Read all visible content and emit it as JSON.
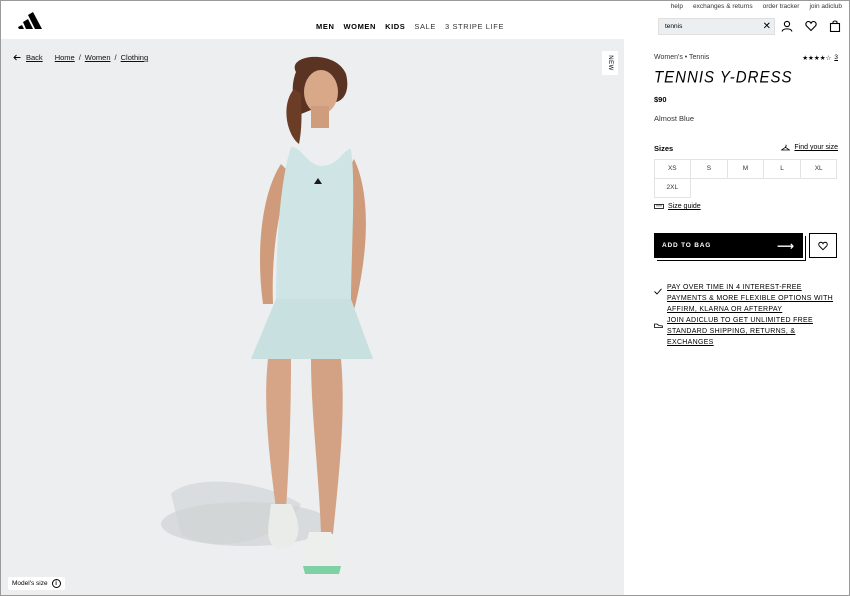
{
  "utility_links": [
    "help",
    "exchanges & returns",
    "order tracker",
    "join adiclub"
  ],
  "nav": {
    "items": [
      {
        "label": "MEN",
        "weight": "bold"
      },
      {
        "label": "WOMEN",
        "weight": "bold"
      },
      {
        "label": "KIDS",
        "weight": "bold"
      },
      {
        "label": "SALE",
        "weight": "light"
      },
      {
        "label": "3 STRIPE LIFE",
        "weight": "light"
      }
    ]
  },
  "search": {
    "value": "tennis",
    "clear_glyph": "✕"
  },
  "breadcrumb": {
    "back_label": "Back",
    "items": [
      "Home",
      "Women",
      "Clothing"
    ],
    "separator": "/"
  },
  "image": {
    "new_tag": "NEW",
    "model_size_label": "Model's size",
    "info_glyph": "i"
  },
  "product": {
    "category": "Women's • Tennis",
    "rating_stars": "★★★★☆",
    "rating_count": "3",
    "title": "TENNIS Y-DRESS",
    "price": "$90",
    "color": "Almost Blue",
    "sizes_label": "Sizes",
    "find_size_label": "Find your size",
    "sizes": [
      "XS",
      "S",
      "M",
      "L",
      "XL",
      "2XL"
    ],
    "size_guide_label": "Size guide",
    "add_to_bag_label": "ADD TO BAG",
    "arrow_glyph": "⟶",
    "promos": [
      {
        "icon": "check-icon",
        "text": "PAY OVER TIME IN 4 INTEREST-FREE PAYMENTS & MORE FLEXIBLE OPTIONS WITH AFFIRM, KLARNA OR AFTERPAY"
      },
      {
        "icon": "shoe-icon",
        "text": "JOIN ADICLUB TO GET UNLIMITED FREE STANDARD SHIPPING, RETURNS, & EXCHANGES"
      }
    ]
  },
  "colors": {
    "hero_bg": "#eceeef",
    "dress": "#cfe5e5",
    "accent": "#000000"
  }
}
